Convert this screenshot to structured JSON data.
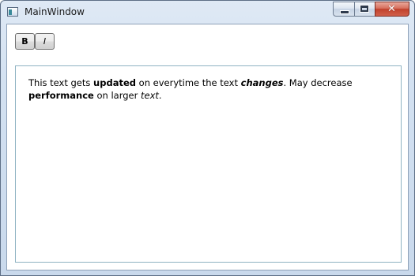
{
  "window": {
    "title": "MainWindow",
    "icons": {
      "app": "window-app-icon",
      "minimize": "minimize-icon",
      "maximize": "maximize-icon",
      "close": "close-icon"
    },
    "close_glyph": "✕"
  },
  "toolbar": {
    "bold_label": "B",
    "italic_label": "I"
  },
  "editor": {
    "runs": [
      {
        "text": "This text gets ",
        "style": "normal"
      },
      {
        "text": "updated",
        "style": "bold"
      },
      {
        "text": " on everytime the text ",
        "style": "normal"
      },
      {
        "text": "changes",
        "style": "bold-italic"
      },
      {
        "text": ".  May decrease ",
        "style": "normal"
      },
      {
        "text": "performance",
        "style": "bold"
      },
      {
        "text": " on larger ",
        "style": "normal"
      },
      {
        "text": "text",
        "style": "italic"
      },
      {
        "text": ".",
        "style": "normal"
      }
    ]
  },
  "colors": {
    "frame": "#d3e1f1",
    "close_button": "#c0412c"
  }
}
